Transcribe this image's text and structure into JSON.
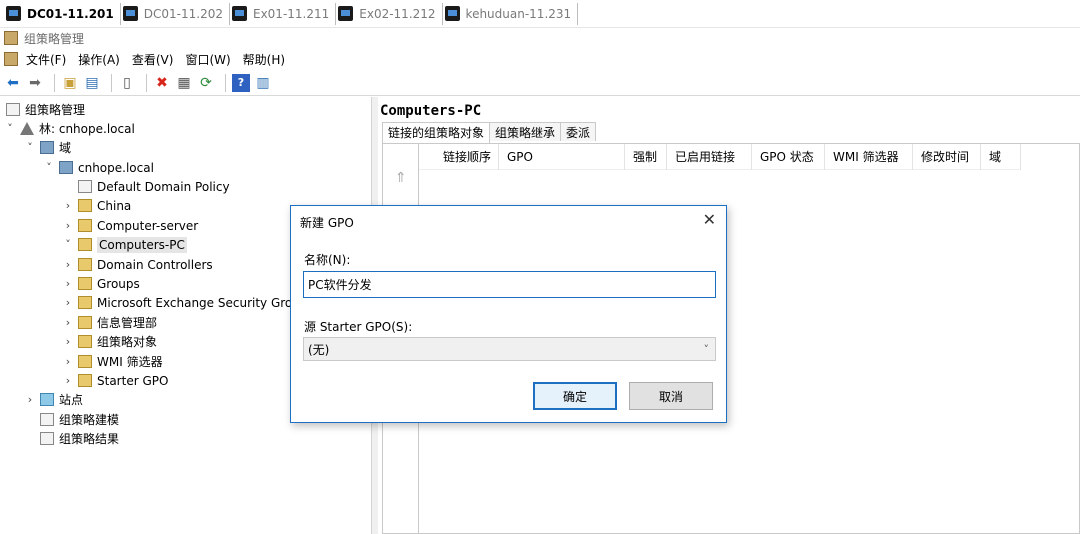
{
  "tabs": [
    {
      "label": "DC01-11.201",
      "active": true
    },
    {
      "label": "DC01-11.202"
    },
    {
      "label": "Ex01-11.211"
    },
    {
      "label": "Ex02-11.212"
    },
    {
      "label": "kehuduan-11.231"
    }
  ],
  "window_title": "组策略管理",
  "menu": [
    "文件(F)",
    "操作(A)",
    "查看(V)",
    "窗口(W)",
    "帮助(H)"
  ],
  "toolbar_icons": [
    "back-arrow-icon",
    "forward-arrow-icon",
    "up-folder-icon",
    "show-tree-icon",
    "properties-icon",
    "delete-icon",
    "export-icon",
    "refresh-icon",
    "help-icon",
    "console-icon"
  ],
  "tree": {
    "root": "组策略管理",
    "forest": "林: cnhope.local",
    "domains": "域",
    "domain": "cnhope.local",
    "children": [
      "Default Domain Policy",
      "China",
      "Computer-server",
      "Computers-PC",
      "Domain Controllers",
      "Groups",
      "Microsoft Exchange Security Grou",
      "信息管理部",
      "组策略对象",
      "WMI 筛选器",
      "Starter GPO"
    ],
    "selected": "Computers-PC",
    "sites": "站点",
    "modeling": "组策略建模",
    "results": "组策略结果"
  },
  "right": {
    "title": "Computers-PC",
    "tabs": [
      "链接的组策略对象",
      "组策略继承",
      "委派"
    ],
    "columns": [
      "链接顺序",
      "GPO",
      "强制",
      "已启用链接",
      "GPO 状态",
      "WMI 筛选器",
      "修改时间",
      "域"
    ]
  },
  "dialog": {
    "title": "新建 GPO",
    "name_label": "名称(N):",
    "name_value": "PC软件分发",
    "starter_label": "源 Starter GPO(S):",
    "starter_value": "(无)",
    "ok": "确定",
    "cancel": "取消"
  }
}
